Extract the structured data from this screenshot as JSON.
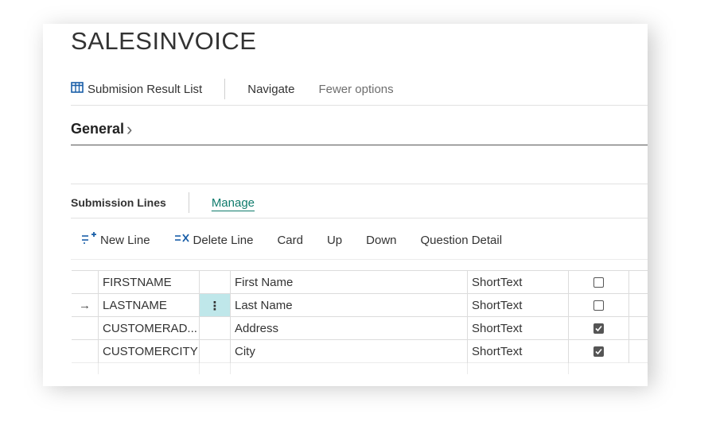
{
  "page": {
    "title": "SALESINVOICE"
  },
  "actionbar": {
    "submission_result_list": "Submision Result List",
    "navigate": "Navigate",
    "fewer_options": "Fewer options"
  },
  "general": {
    "label": "General",
    "chevron": "›"
  },
  "subpage": {
    "title": "Submission Lines",
    "manage": "Manage",
    "actions": {
      "new_line": "New Line",
      "delete_line": "Delete Line",
      "card": "Card",
      "up": "Up",
      "down": "Down",
      "question_detail": "Question Detail"
    }
  },
  "grid": {
    "rows": [
      {
        "marker": "",
        "code": "FIRSTNAME",
        "menu": "",
        "description": "First Name",
        "type": "ShortText",
        "checked": false
      },
      {
        "marker": "→",
        "code": "LASTNAME",
        "menu": "⋮",
        "description": "Last Name",
        "type": "ShortText",
        "checked": false
      },
      {
        "marker": "",
        "code": "CUSTOMERAD...",
        "menu": "",
        "description": "Address",
        "type": "ShortText",
        "checked": true
      },
      {
        "marker": "",
        "code": "CUSTOMERCITY",
        "menu": "",
        "description": "City",
        "type": "ShortText",
        "checked": true
      }
    ]
  },
  "icons": {
    "list": "list-icon",
    "new_line": "new-line-icon",
    "delete_line": "delete-line-icon",
    "checkmark": "checkmark-icon"
  },
  "colors": {
    "accent": "#0f7b6c",
    "selected_cell": "#bfe7ea"
  }
}
